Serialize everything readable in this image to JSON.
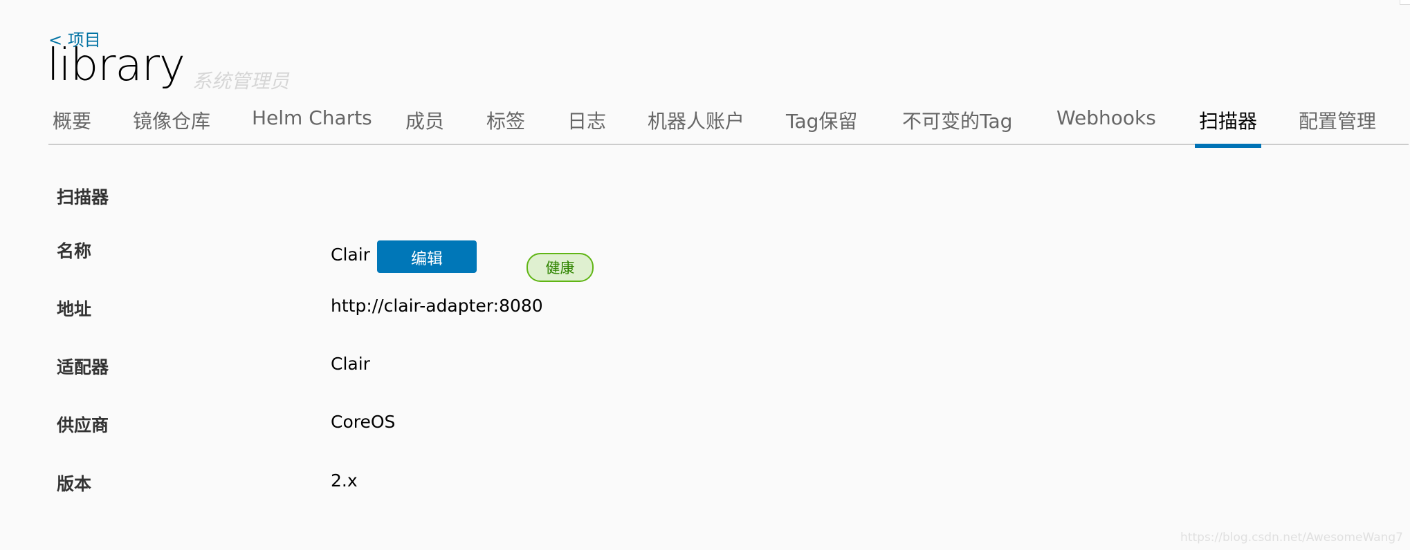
{
  "breadcrumb": {
    "back_label": "< 项目"
  },
  "header": {
    "title": "library",
    "role": "系统管理员"
  },
  "tabs": [
    {
      "label": "概要",
      "active": false
    },
    {
      "label": "镜像仓库",
      "active": false
    },
    {
      "label": "Helm Charts",
      "active": false
    },
    {
      "label": "成员",
      "active": false
    },
    {
      "label": "标签",
      "active": false
    },
    {
      "label": "日志",
      "active": false
    },
    {
      "label": "机器人账户",
      "active": false
    },
    {
      "label": "Tag保留",
      "active": false
    },
    {
      "label": "不可变的Tag",
      "active": false
    },
    {
      "label": "Webhooks",
      "active": false
    },
    {
      "label": "扫描器",
      "active": true
    },
    {
      "label": "配置管理",
      "active": false
    }
  ],
  "scanner": {
    "section_title": "扫描器",
    "rows": [
      {
        "label": "名称",
        "value": "Clair"
      },
      {
        "label": "地址",
        "value": "http://clair-adapter:8080"
      },
      {
        "label": "适配器",
        "value": "Clair"
      },
      {
        "label": "供应商",
        "value": "CoreOS"
      },
      {
        "label": "版本",
        "value": "2.x"
      }
    ],
    "edit_label": "编辑",
    "health_status": "健康"
  },
  "colors": {
    "accent": "#0077b8",
    "health_bg": "#dff0d0",
    "health_border": "#60b515",
    "health_text": "#2f8400"
  },
  "watermark": "https://blog.csdn.net/AwesomeWang7"
}
